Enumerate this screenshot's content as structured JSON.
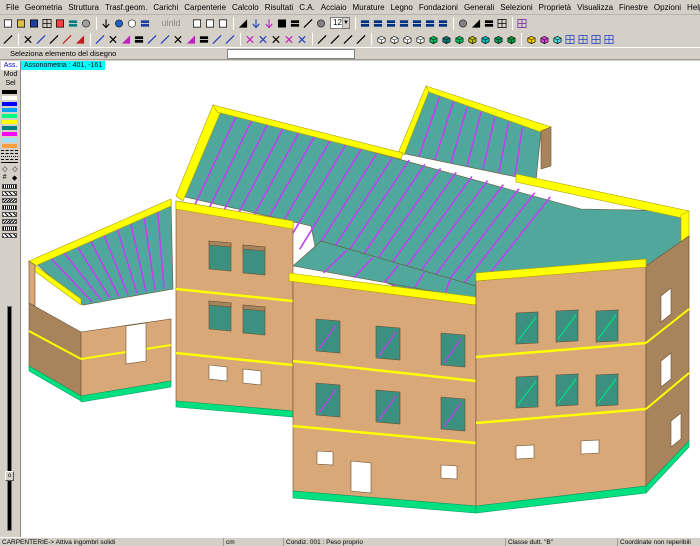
{
  "menu": [
    "File",
    "Geometria",
    "Struttura",
    "Trasf.geom.",
    "Carichi",
    "Carpenterie",
    "Calcolo",
    "Risultati",
    "C.A.",
    "Acciaio",
    "Murature",
    "Legno",
    "Fondazioni",
    "Generali",
    "Selezioni",
    "Proprietà",
    "Visualizza",
    "Finestre",
    "Opzioni",
    "Help"
  ],
  "toolbar1": {
    "icons": [
      "new-icon",
      "open-icon",
      "save-icon",
      "print-icon",
      "copy-icon",
      "paste-icon",
      "undo-icon",
      "redo-icon",
      "zoom-icon",
      "text-icon",
      "chart-icon",
      "move-icon",
      "arrow-icon",
      "layer-icon",
      "color-icon",
      "check-icon",
      "grid-icon"
    ],
    "combo_value": "12",
    "small_label": "ulnld"
  },
  "command": {
    "prompt": "Seleziona  elemento del disegno",
    "input_value": ""
  },
  "sidebar": {
    "views": [
      "Ass.",
      "Mod",
      "Sel"
    ],
    "active_view": "Ass.",
    "swatch_colors": [
      "#000000",
      "#ffffff",
      "#0000ff",
      "#00a0ff",
      "#00ff80",
      "#ffff00",
      "#008080",
      "#ff00ff",
      "#9fe0ff",
      "#ff9f40"
    ]
  },
  "canvas": {
    "view_info": "Assonometria :  401, -161",
    "colors": {
      "wall": "#d8a878",
      "wall_shadow": "#a8845c",
      "edge": "#ffff00",
      "slab": "#50a89c",
      "joist": "#c040f0",
      "base": "#00e080",
      "window": "#3c9080"
    }
  },
  "status": {
    "mode": "CARPENTERIE-> Attiva ingombri solidi",
    "units": "cm",
    "condition": "Condiz. 001 : Peso proprio",
    "class": "Classe dutt. \"B\"",
    "coords": "Coordinate non reperibili"
  }
}
